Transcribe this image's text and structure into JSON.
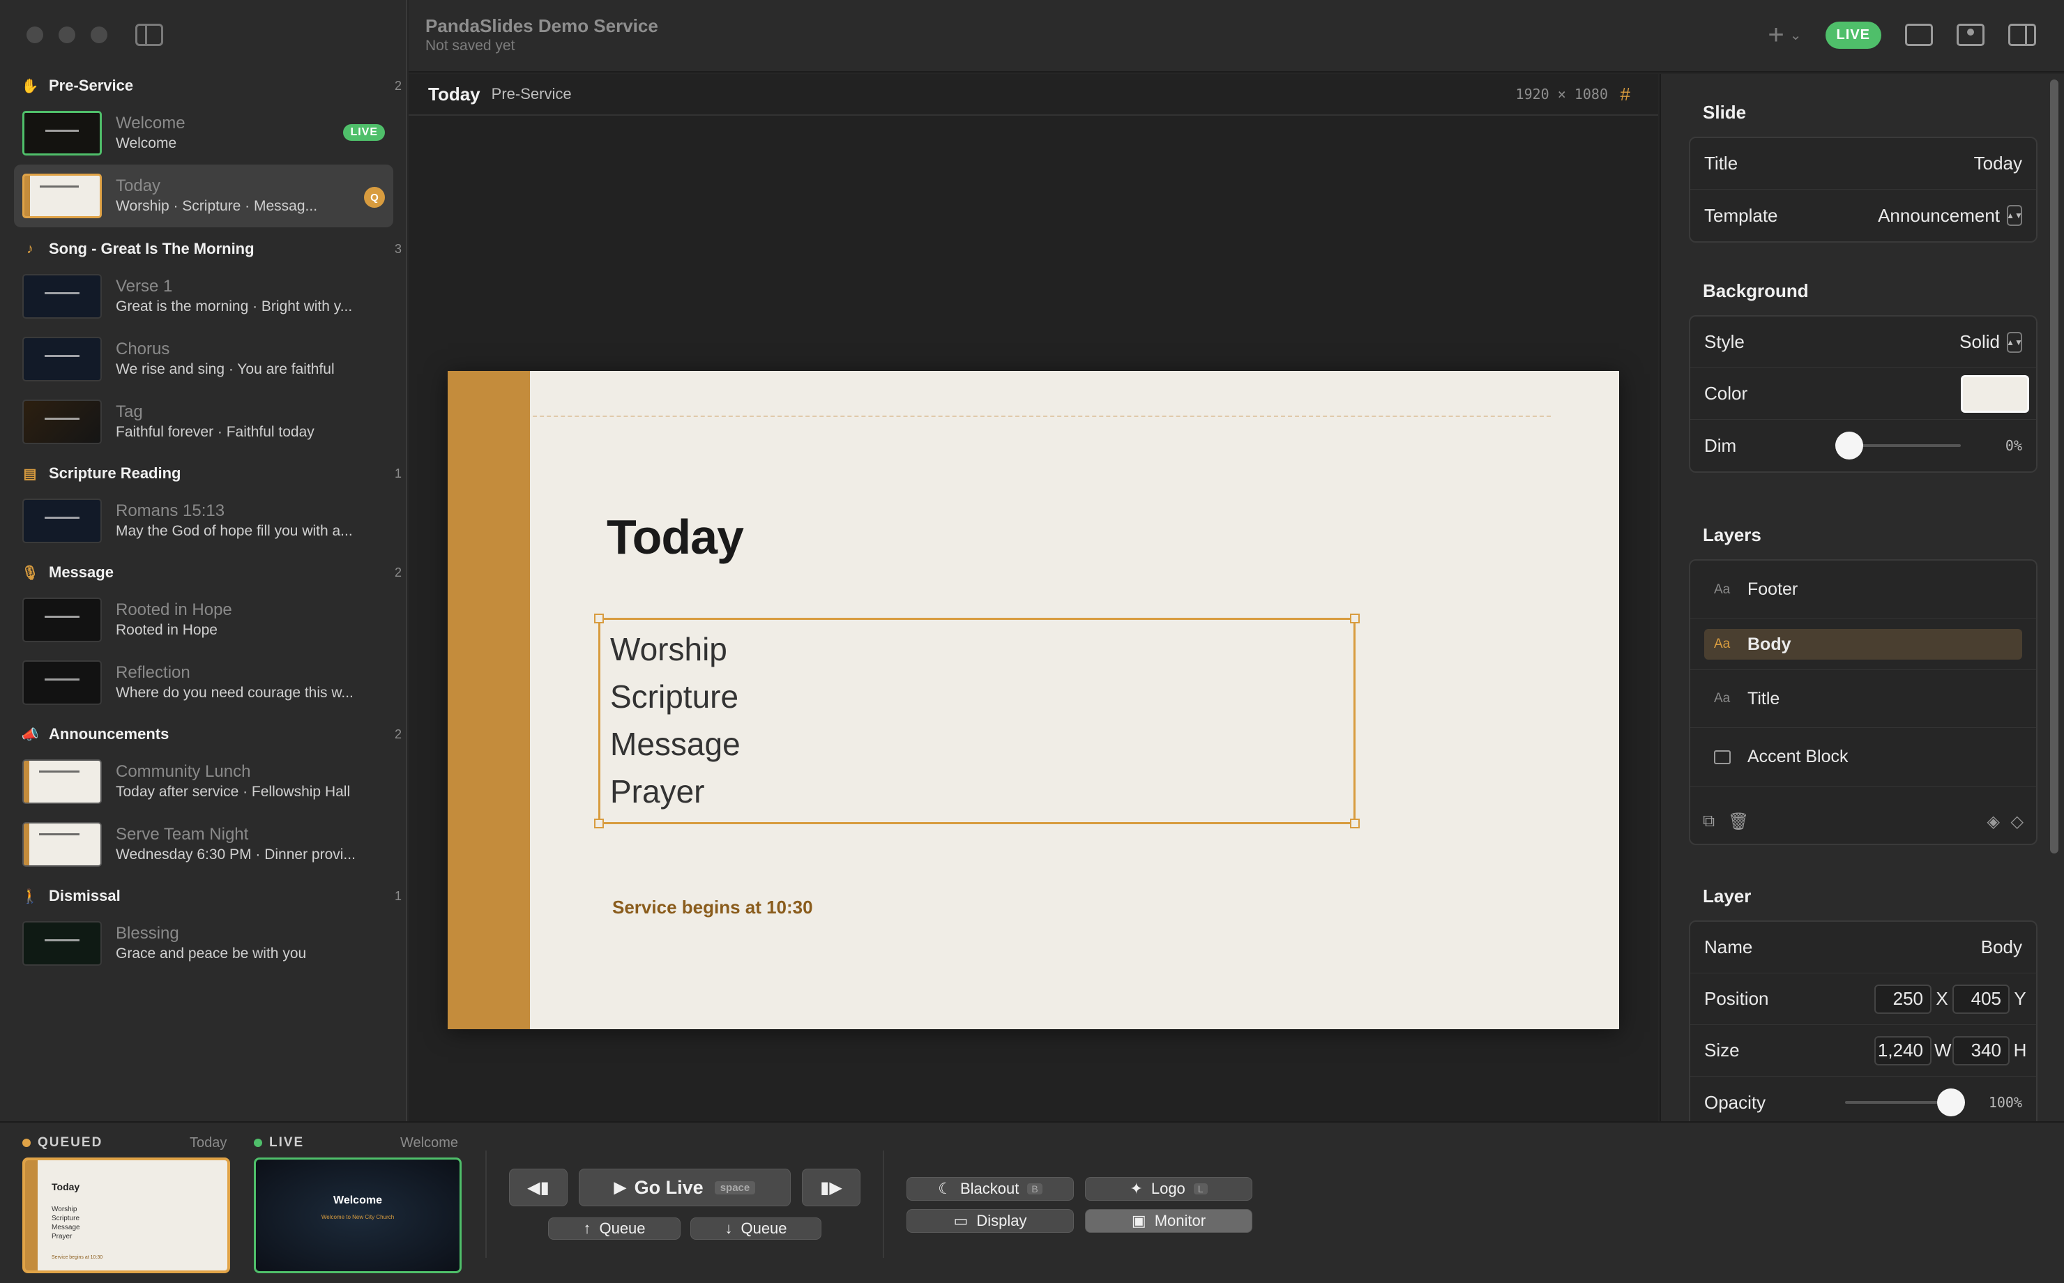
{
  "window": {
    "title": "PandaSlides Demo Service",
    "subtitle": "Not saved yet",
    "live_label": "LIVE"
  },
  "sidebar": {
    "sections": [
      {
        "name": "Pre-Service",
        "count": "2",
        "icon": "hand-wave-icon"
      },
      {
        "name": "Song - Great Is The Morning",
        "count": "3",
        "icon": "music-note-icon"
      },
      {
        "name": "Scripture Reading",
        "count": "1",
        "icon": "book-icon"
      },
      {
        "name": "Message",
        "count": "2",
        "icon": "microphone-icon"
      },
      {
        "name": "Announcements",
        "count": "2",
        "icon": "megaphone-icon"
      },
      {
        "name": "Dismissal",
        "count": "1",
        "icon": "walking-person-icon"
      }
    ],
    "items": [
      {
        "title": "Welcome",
        "sub": "Welcome",
        "badge": "LIVE"
      },
      {
        "title": "Today",
        "sub": "Worship · Scripture · Messag...",
        "badge": "Q"
      },
      {
        "title": "Verse 1",
        "sub": "Great is the morning · Bright with y..."
      },
      {
        "title": "Chorus",
        "sub": "We rise and sing · You are faithful"
      },
      {
        "title": "Tag",
        "sub": "Faithful forever · Faithful today"
      },
      {
        "title": "Romans 15:13",
        "sub": "May the God of hope fill you with a..."
      },
      {
        "title": "Rooted in Hope",
        "sub": "Rooted in Hope"
      },
      {
        "title": "Reflection",
        "sub": "Where do you need courage this w..."
      },
      {
        "title": "Community Lunch",
        "sub": "Today after service · Fellowship Hall"
      },
      {
        "title": "Serve Team Night",
        "sub": "Wednesday 6:30 PM · Dinner provi..."
      },
      {
        "title": "Blessing",
        "sub": "Grace and peace be with you"
      }
    ]
  },
  "editor": {
    "title": "Today",
    "crumb": "Pre-Service",
    "resolution": "1920 × 1080",
    "slide": {
      "title": "Today",
      "body": [
        "Worship",
        "Scripture",
        "Message",
        "Prayer"
      ],
      "footer": "Service begins at 10:30",
      "accent_color": "#c48c3c",
      "background_color": "#f0ede6"
    }
  },
  "inspector": {
    "slide_heading": "Slide",
    "title_label": "Title",
    "title_value": "Today",
    "template_label": "Template",
    "template_value": "Announcement",
    "bg_heading": "Background",
    "style_label": "Style",
    "style_value": "Solid",
    "color_label": "Color",
    "dim_label": "Dim",
    "dim_value": "0%",
    "dim_level": 0,
    "layers_heading": "Layers",
    "layers": [
      {
        "name": "Footer",
        "icon": "text-aa-icon"
      },
      {
        "name": "Body",
        "icon": "text-aa-icon"
      },
      {
        "name": "Title",
        "icon": "text-aa-icon"
      },
      {
        "name": "Accent Block",
        "icon": "rectangle-icon"
      }
    ],
    "layer_heading": "Layer",
    "name_label": "Name",
    "name_value": "Body",
    "position_label": "Position",
    "pos_x": "250",
    "pos_y": "405",
    "x_unit": "X",
    "y_unit": "Y",
    "size_label": "Size",
    "size_w": "1,240",
    "size_h": "340",
    "w_unit": "W",
    "h_unit": "H",
    "opacity_label": "Opacity",
    "opacity_value": "100%",
    "opacity_level": 1.0
  },
  "bottom": {
    "queued_label": "QUEUED",
    "queued_name": "Today",
    "live_label": "LIVE",
    "live_name": "Welcome",
    "queued_preview": {
      "title": "Today",
      "lines": [
        "Worship",
        "Scripture",
        "Message",
        "Prayer"
      ],
      "footer": "Service begins at 10:30"
    },
    "live_preview": {
      "title": "Welcome",
      "sub": "Welcome to New City Church"
    },
    "go_live": "Go Live",
    "go_live_key": "space",
    "queue_up": "Queue",
    "queue_down": "Queue",
    "blackout": "Blackout",
    "blackout_key": "B",
    "logo": "Logo",
    "logo_key": "L",
    "display": "Display",
    "monitor": "Monitor"
  }
}
